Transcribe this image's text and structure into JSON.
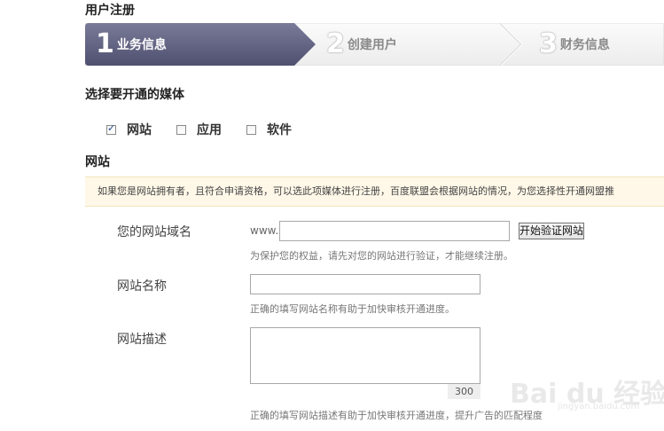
{
  "page": {
    "title": "用户注册"
  },
  "steps": [
    {
      "number": "1",
      "label": "业务信息",
      "active": true
    },
    {
      "number": "2",
      "label": "创建用户",
      "active": false
    },
    {
      "number": "3",
      "label": "财务信息",
      "active": false
    }
  ],
  "media": {
    "title": "选择要开通的媒体",
    "options": [
      {
        "label": "网站",
        "checked": true
      },
      {
        "label": "应用",
        "checked": false
      },
      {
        "label": "软件",
        "checked": false
      }
    ]
  },
  "website": {
    "title": "网站",
    "notice": "如果您是网站拥有者，且符合申请资格，可以选此项媒体进行注册，百度联盟会根据网站的情况，为您选择性开通网盟推",
    "domain": {
      "label": "您的网站域名",
      "prefix": "www.",
      "value": "",
      "verify_button": "开始验证网站",
      "hint": "为保护您的权益，请先对您的网站进行验证，才能继续注册。"
    },
    "name": {
      "label": "网站名称",
      "value": "",
      "hint": "正确的填写网站名称有助于加快审核开通进度。"
    },
    "description": {
      "label": "网站描述",
      "value": "",
      "counter": "300",
      "hint": "正确的填写网站描述有助于加快审核开通进度，提升广告的匹配程度"
    }
  },
  "watermark": {
    "text": "Bai du 经验",
    "sub": "jingyan.baidu.com"
  },
  "colors": {
    "active_step": "#5e5f7e",
    "inactive_step": "#f2f2f2",
    "notice_bg": "#fff8e8"
  }
}
